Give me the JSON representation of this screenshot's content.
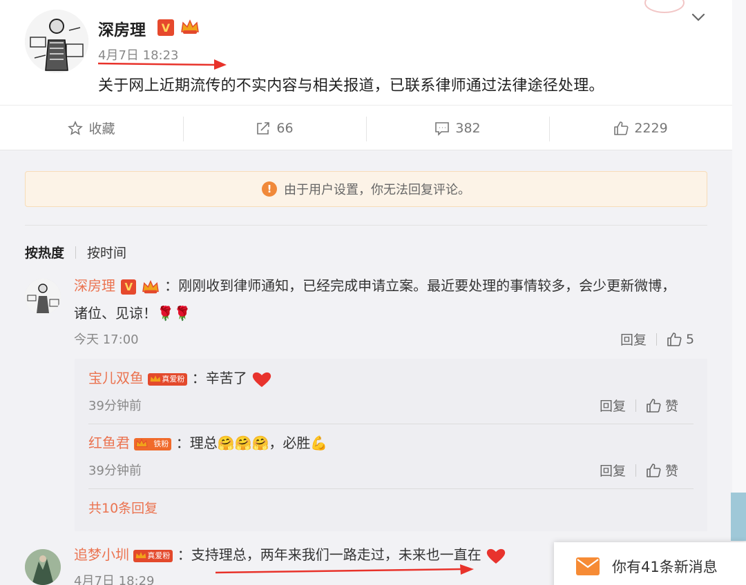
{
  "post": {
    "author": "深房理",
    "verified_badge": "V",
    "time": "4月7日 18:23",
    "text": "关于网上近期流传的不实内容与相关报道，已联系律师通过法律途径处理。"
  },
  "actions": {
    "favorite_label": "收藏",
    "repost_count": "66",
    "comment_count": "382",
    "like_count": "2229"
  },
  "notice": {
    "icon_text": "!",
    "text": "由于用户设置，你无法回复评论。"
  },
  "sort": {
    "hot_label": "按热度",
    "time_label": "按时间"
  },
  "comments": [
    {
      "username": "深房理",
      "verified_badge": "V",
      "text_line1": "：刚刚收到律师通知，已经完成申请立案。最近要处理的事情较多，会少更新微博，",
      "text_line2": "诸位、见谅！🌹🌹",
      "time": "今天 17:00",
      "reply_label": "回复",
      "like_count": "5",
      "replies": [
        {
          "username": "宝儿双鱼",
          "fan_badge": "真爱粉",
          "text": "：辛苦了",
          "time": "39分钟前",
          "reply_label": "回复",
          "like_label": "赞"
        },
        {
          "username": "红鱼君",
          "fan_badge": "铁粉",
          "text": "：理总🤗🤗🤗，必胜💪",
          "time": "39分钟前",
          "reply_label": "回复",
          "like_label": "赞"
        }
      ],
      "more_replies": "共10条回复"
    },
    {
      "username": "追梦小圳",
      "fan_badge": "真爱粉",
      "text": "：支持理总，两年来我们一路走过，未来也一直在",
      "time": "4月7日 18:29"
    }
  ],
  "message_popup": {
    "text": "你有41条新消息"
  },
  "colors": {
    "username": "#eb7350",
    "annotation_arrow": "#e8322a",
    "notice_bg": "#fcf3e7",
    "mail_icon": "#f68b35"
  }
}
